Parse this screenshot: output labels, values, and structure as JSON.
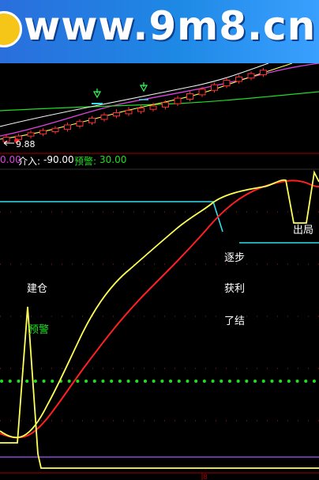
{
  "banner": {
    "text": "www.9m8.cn"
  },
  "price_panel": {
    "price_label": "9.88",
    "candles": [
      {
        "o": 9.86,
        "c": 9.9,
        "h": 9.92,
        "l": 9.84
      },
      {
        "o": 9.88,
        "c": 9.91,
        "h": 9.93,
        "l": 9.86
      },
      {
        "o": 9.91,
        "c": 9.94,
        "h": 9.96,
        "l": 9.89
      },
      {
        "o": 9.93,
        "c": 9.96,
        "h": 9.98,
        "l": 9.91
      },
      {
        "o": 9.95,
        "c": 9.98,
        "h": 10.0,
        "l": 9.93
      },
      {
        "o": 9.97,
        "c": 10.01,
        "h": 10.03,
        "l": 9.95
      },
      {
        "o": 10.0,
        "c": 10.04,
        "h": 10.06,
        "l": 9.98
      },
      {
        "o": 10.03,
        "c": 10.07,
        "h": 10.09,
        "l": 10.01
      },
      {
        "o": 10.06,
        "c": 10.1,
        "h": 10.12,
        "l": 10.04
      },
      {
        "o": 10.09,
        "c": 10.12,
        "h": 10.15,
        "l": 10.07
      },
      {
        "o": 10.11,
        "c": 10.14,
        "h": 10.17,
        "l": 10.09
      },
      {
        "o": 10.13,
        "c": 10.16,
        "h": 10.19,
        "l": 10.11
      },
      {
        "o": 10.15,
        "c": 10.18,
        "h": 10.21,
        "l": 10.13
      },
      {
        "o": 10.17,
        "c": 10.21,
        "h": 10.23,
        "l": 10.15
      },
      {
        "o": 10.2,
        "c": 10.25,
        "h": 10.27,
        "l": 10.18
      },
      {
        "o": 10.24,
        "c": 10.29,
        "h": 10.31,
        "l": 10.22
      },
      {
        "o": 10.28,
        "c": 10.33,
        "h": 10.35,
        "l": 10.26
      },
      {
        "o": 10.32,
        "c": 10.37,
        "h": 10.39,
        "l": 10.3
      },
      {
        "o": 10.36,
        "c": 10.41,
        "h": 10.43,
        "l": 10.34
      },
      {
        "o": 10.4,
        "c": 10.44,
        "h": 10.46,
        "l": 10.38
      },
      {
        "o": 10.43,
        "c": 10.47,
        "h": 10.49,
        "l": 10.41
      },
      {
        "o": 10.46,
        "c": 10.5,
        "h": 10.52,
        "l": 10.44
      }
    ]
  },
  "indicator_header": {
    "value_partial": "0.00",
    "entry_label": "介入:",
    "entry_value": "-90.00",
    "warn_label": "预警:",
    "warn_value": "30.00"
  },
  "annotations": {
    "build_position": "建仓",
    "early_warning": "预警",
    "step": "逐步",
    "take_profit": "获利",
    "close_out": "了结",
    "exit": "出局"
  },
  "time_axis": {
    "label": "8"
  },
  "colors": {
    "yellow": "#ffff55",
    "red": "#ff2020",
    "cyan": "#33ddee",
    "green": "#22dd22",
    "magenta": "#dd44dd",
    "purple_line": "#aa55ff"
  }
}
